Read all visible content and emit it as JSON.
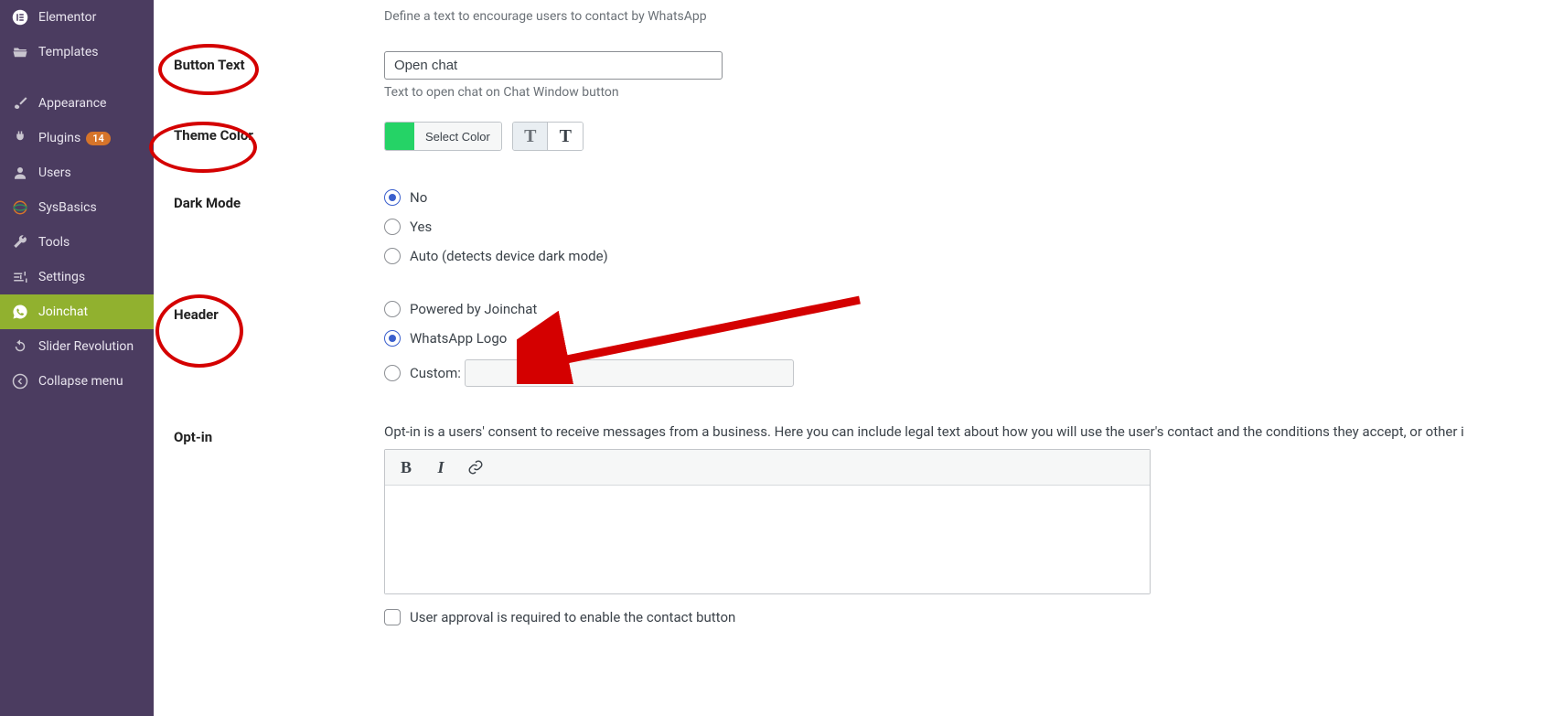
{
  "sidebar": {
    "items": [
      {
        "label": "Elementor",
        "icon": "elementor-icon"
      },
      {
        "label": "Templates",
        "icon": "folder-open-icon"
      },
      {
        "label": "Appearance",
        "icon": "brush-icon"
      },
      {
        "label": "Plugins",
        "icon": "plug-icon",
        "badge": "14"
      },
      {
        "label": "Users",
        "icon": "user-icon"
      },
      {
        "label": "SysBasics",
        "icon": "sphere-icon"
      },
      {
        "label": "Tools",
        "icon": "wrench-icon"
      },
      {
        "label": "Settings",
        "icon": "sliders-icon"
      },
      {
        "label": "Joinchat",
        "icon": "whatsapp-icon",
        "active": true
      },
      {
        "label": "Slider Revolution",
        "icon": "refresh-icon"
      },
      {
        "label": "Collapse menu",
        "icon": "collapse-icon"
      }
    ]
  },
  "rows": {
    "intro_desc": "Define a text to encourage users to contact by WhatsApp",
    "button_text": {
      "label": "Button Text",
      "value": "Open chat",
      "desc": "Text to open chat on Chat Window button"
    },
    "theme_color": {
      "label": "Theme Color",
      "button": "Select Color",
      "swatch": "#25d366"
    },
    "dark_mode": {
      "label": "Dark Mode",
      "options": {
        "no": "No",
        "yes": "Yes",
        "auto": "Auto (detects device dark mode)"
      },
      "selected": "no"
    },
    "header": {
      "label": "Header",
      "options": {
        "powered": "Powered by Joinchat",
        "whatsapp": "WhatsApp Logo",
        "custom": "Custom:"
      },
      "selected": "whatsapp"
    },
    "optin": {
      "label": "Opt-in",
      "desc": "Opt-in is a users' consent to receive messages from a business. Here you can include legal text about how you will use the user's contact and the conditions they accept, or other i",
      "approval_label": "User approval is required to enable the contact button"
    }
  }
}
